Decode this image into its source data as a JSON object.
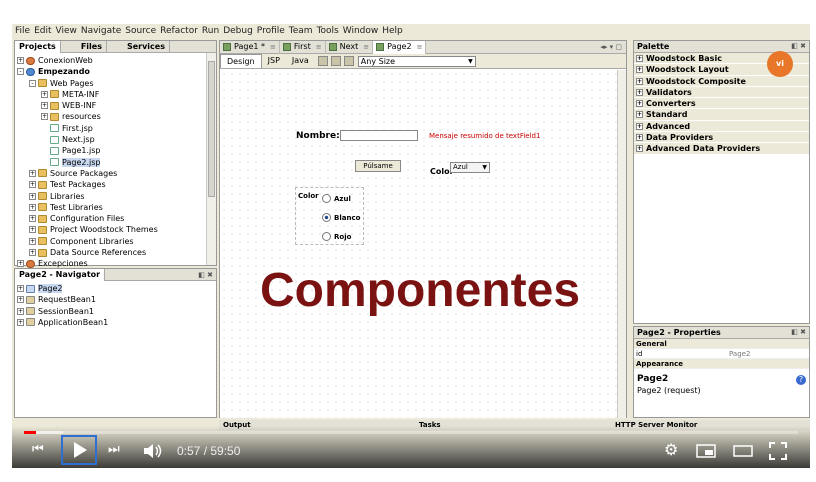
{
  "menu": [
    "File",
    "Edit",
    "View",
    "Navigate",
    "Source",
    "Refactor",
    "Run",
    "Debug",
    "Profile",
    "Team",
    "Tools",
    "Window",
    "Help"
  ],
  "projects_panel": {
    "tabs": [
      "Projects",
      "Files",
      "Services"
    ],
    "tree": [
      {
        "label": "ConexionWeb",
        "depth": 0,
        "icon": "proj",
        "exp": "+"
      },
      {
        "label": "Empezando",
        "depth": 0,
        "icon": "globe",
        "exp": "-",
        "bold": true
      },
      {
        "label": "Web Pages",
        "depth": 1,
        "icon": "folder",
        "exp": "-"
      },
      {
        "label": "META-INF",
        "depth": 2,
        "icon": "folder",
        "exp": "+"
      },
      {
        "label": "WEB-INF",
        "depth": 2,
        "icon": "folder",
        "exp": "+"
      },
      {
        "label": "resources",
        "depth": 2,
        "icon": "folder",
        "exp": "+"
      },
      {
        "label": "First.jsp",
        "depth": 2,
        "icon": "jsp"
      },
      {
        "label": "Next.jsp",
        "depth": 2,
        "icon": "jsp"
      },
      {
        "label": "Page1.jsp",
        "depth": 2,
        "icon": "jsp"
      },
      {
        "label": "Page2.jsp",
        "depth": 2,
        "icon": "jsp",
        "selected": true
      },
      {
        "label": "Source Packages",
        "depth": 1,
        "icon": "folder",
        "exp": "+"
      },
      {
        "label": "Test Packages",
        "depth": 1,
        "icon": "folder",
        "exp": "+"
      },
      {
        "label": "Libraries",
        "depth": 1,
        "icon": "folder",
        "exp": "+"
      },
      {
        "label": "Test Libraries",
        "depth": 1,
        "icon": "folder",
        "exp": "+"
      },
      {
        "label": "Configuration Files",
        "depth": 1,
        "icon": "folder",
        "exp": "+"
      },
      {
        "label": "Project Woodstock Themes",
        "depth": 1,
        "icon": "folder",
        "exp": "+"
      },
      {
        "label": "Component Libraries",
        "depth": 1,
        "icon": "folder",
        "exp": "+"
      },
      {
        "label": "Data Source References",
        "depth": 1,
        "icon": "folder",
        "exp": "+"
      },
      {
        "label": "Excepciones",
        "depth": 0,
        "icon": "proj",
        "exp": "+"
      }
    ]
  },
  "navigator": {
    "title": "Page2 - Navigator",
    "items": [
      {
        "label": "Page2",
        "icon": "page",
        "selected": true
      },
      {
        "label": "RequestBean1",
        "icon": "bean"
      },
      {
        "label": "SessionBean1",
        "icon": "bean"
      },
      {
        "label": "ApplicationBean1",
        "icon": "bean"
      }
    ]
  },
  "editor": {
    "tabs": [
      "Page1 *",
      "First",
      "Next",
      "Page2"
    ],
    "active_tab": 3,
    "view_tabs": [
      "Design",
      "JSP",
      "Java"
    ],
    "size_select": "Any Size"
  },
  "form": {
    "nombre_label": "Nombre:",
    "message": "Mensaje resumido de textField1",
    "button": "Púlsame",
    "color_label": "Color",
    "color_select": "Azul",
    "radio_label": "Color",
    "radios": [
      {
        "label": "Azul",
        "checked": false
      },
      {
        "label": "Blanco",
        "checked": true
      },
      {
        "label": "Rojo",
        "checked": false
      }
    ],
    "overlay_title": "Componentes"
  },
  "palette": {
    "title": "Palette",
    "logo_text": "vi",
    "categories": [
      "Woodstock Basic",
      "Woodstock Layout",
      "Woodstock Composite",
      "Validators",
      "Converters",
      "Standard",
      "Advanced",
      "Data Providers",
      "Advanced Data Providers"
    ]
  },
  "properties": {
    "title": "Page2 - Properties",
    "group": "General",
    "rows": [
      {
        "name": "id",
        "value": "Page2"
      }
    ],
    "group2": "Appearance",
    "selected_name": "Page2",
    "selected_desc": "Page2 (request)"
  },
  "bottom_tabs": [
    "Output",
    "Tasks",
    "HTTP Server Monitor"
  ],
  "player": {
    "time": "0:57 / 59:50",
    "progress": 0.016,
    "loaded": 0.05,
    "accent": "#ff0000"
  }
}
